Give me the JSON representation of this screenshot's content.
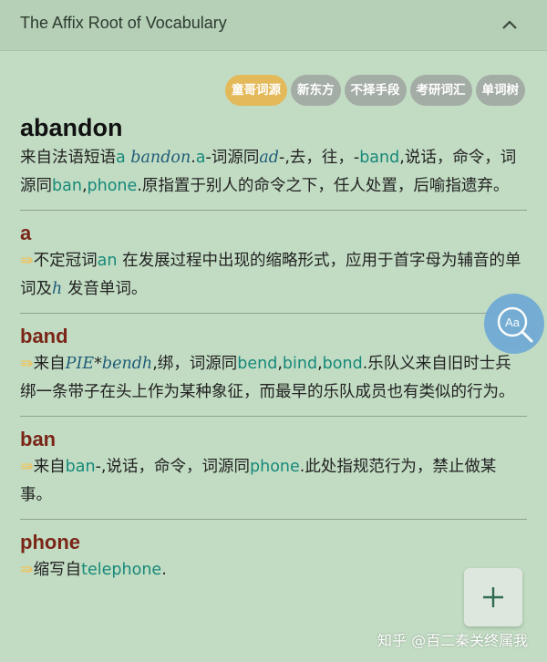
{
  "header": {
    "title": "The Affix Root of Vocabulary",
    "collapse_icon": "chevron-up-icon"
  },
  "tags": [
    "童哥词源",
    "新东方",
    "不择手段",
    "考研词汇",
    "单词树"
  ],
  "word": {
    "title": "abandon",
    "etym": [
      {
        "t": "来自法语短语",
        "s": "n"
      },
      {
        "t": "a ",
        "s": "g"
      },
      {
        "t": "bandon",
        "s": "i"
      },
      {
        "t": ".",
        "s": "n"
      },
      {
        "t": "a",
        "s": "g"
      },
      {
        "t": "-词源同",
        "s": "n"
      },
      {
        "t": "ad",
        "s": "i"
      },
      {
        "t": "-,去，往，-",
        "s": "n"
      },
      {
        "t": "band",
        "s": "g"
      },
      {
        "t": ",说话，命令，词源同",
        "s": "n"
      },
      {
        "t": "ban",
        "s": "g"
      },
      {
        "t": ",",
        "s": "n"
      },
      {
        "t": "phone",
        "s": "g"
      },
      {
        "t": ".原指置于别人的命令之下，任人处置，后喻指遗弃。",
        "s": "n"
      }
    ]
  },
  "parts": [
    {
      "title": "a",
      "text": [
        {
          "t": "⇛",
          "s": "a"
        },
        {
          "t": "不定冠词",
          "s": "n"
        },
        {
          "t": "an",
          "s": "g"
        },
        {
          "t": " 在发展过程中出现的缩略形式，应用于首字母为辅音的单词及",
          "s": "n"
        },
        {
          "t": "h",
          "s": "i"
        },
        {
          "t": " 发音单词。",
          "s": "n"
        }
      ]
    },
    {
      "title": "band",
      "text": [
        {
          "t": "⇛",
          "s": "a"
        },
        {
          "t": "来自",
          "s": "n"
        },
        {
          "t": "PIE",
          "s": "i"
        },
        {
          "t": "*",
          "s": "n"
        },
        {
          "t": "bendh",
          "s": "i"
        },
        {
          "t": ",绑，词源同",
          "s": "n"
        },
        {
          "t": "bend",
          "s": "g"
        },
        {
          "t": ",",
          "s": "n"
        },
        {
          "t": "bind",
          "s": "g"
        },
        {
          "t": ",",
          "s": "n"
        },
        {
          "t": "bond",
          "s": "g"
        },
        {
          "t": ".乐队义来自旧时士兵绑一条带子在头上作为某种象征，而最早的乐队成员也有类似的行为。",
          "s": "n"
        }
      ]
    },
    {
      "title": "ban",
      "text": [
        {
          "t": "⇛",
          "s": "a"
        },
        {
          "t": "来自",
          "s": "n"
        },
        {
          "t": "ban",
          "s": "g"
        },
        {
          "t": "-,说话，命令，词源同",
          "s": "n"
        },
        {
          "t": "phone",
          "s": "g"
        },
        {
          "t": ".此处指规范行为，禁止做某事。",
          "s": "n"
        }
      ]
    },
    {
      "title": "phone",
      "text": [
        {
          "t": "⇛",
          "s": "a"
        },
        {
          "t": "缩写自",
          "s": "n"
        },
        {
          "t": "telephone",
          "s": "g"
        },
        {
          "t": ".",
          "s": "n"
        }
      ]
    }
  ],
  "float_button": {
    "label": "Aa",
    "icon": "search-text-icon"
  },
  "fab": {
    "label": "+",
    "icon": "plus-icon"
  },
  "watermark": "知乎 @百二秦关终属我",
  "colors": {
    "background": "#c2dcc3",
    "header": "#b5d0b7",
    "tag": "#a4aca6",
    "tag_active": "#e3b959",
    "link": "#16897a",
    "italic": "#1f5c78",
    "part_title": "#7a2518",
    "arrow": "#e9c66a",
    "float_button": "#6ea9d6"
  }
}
